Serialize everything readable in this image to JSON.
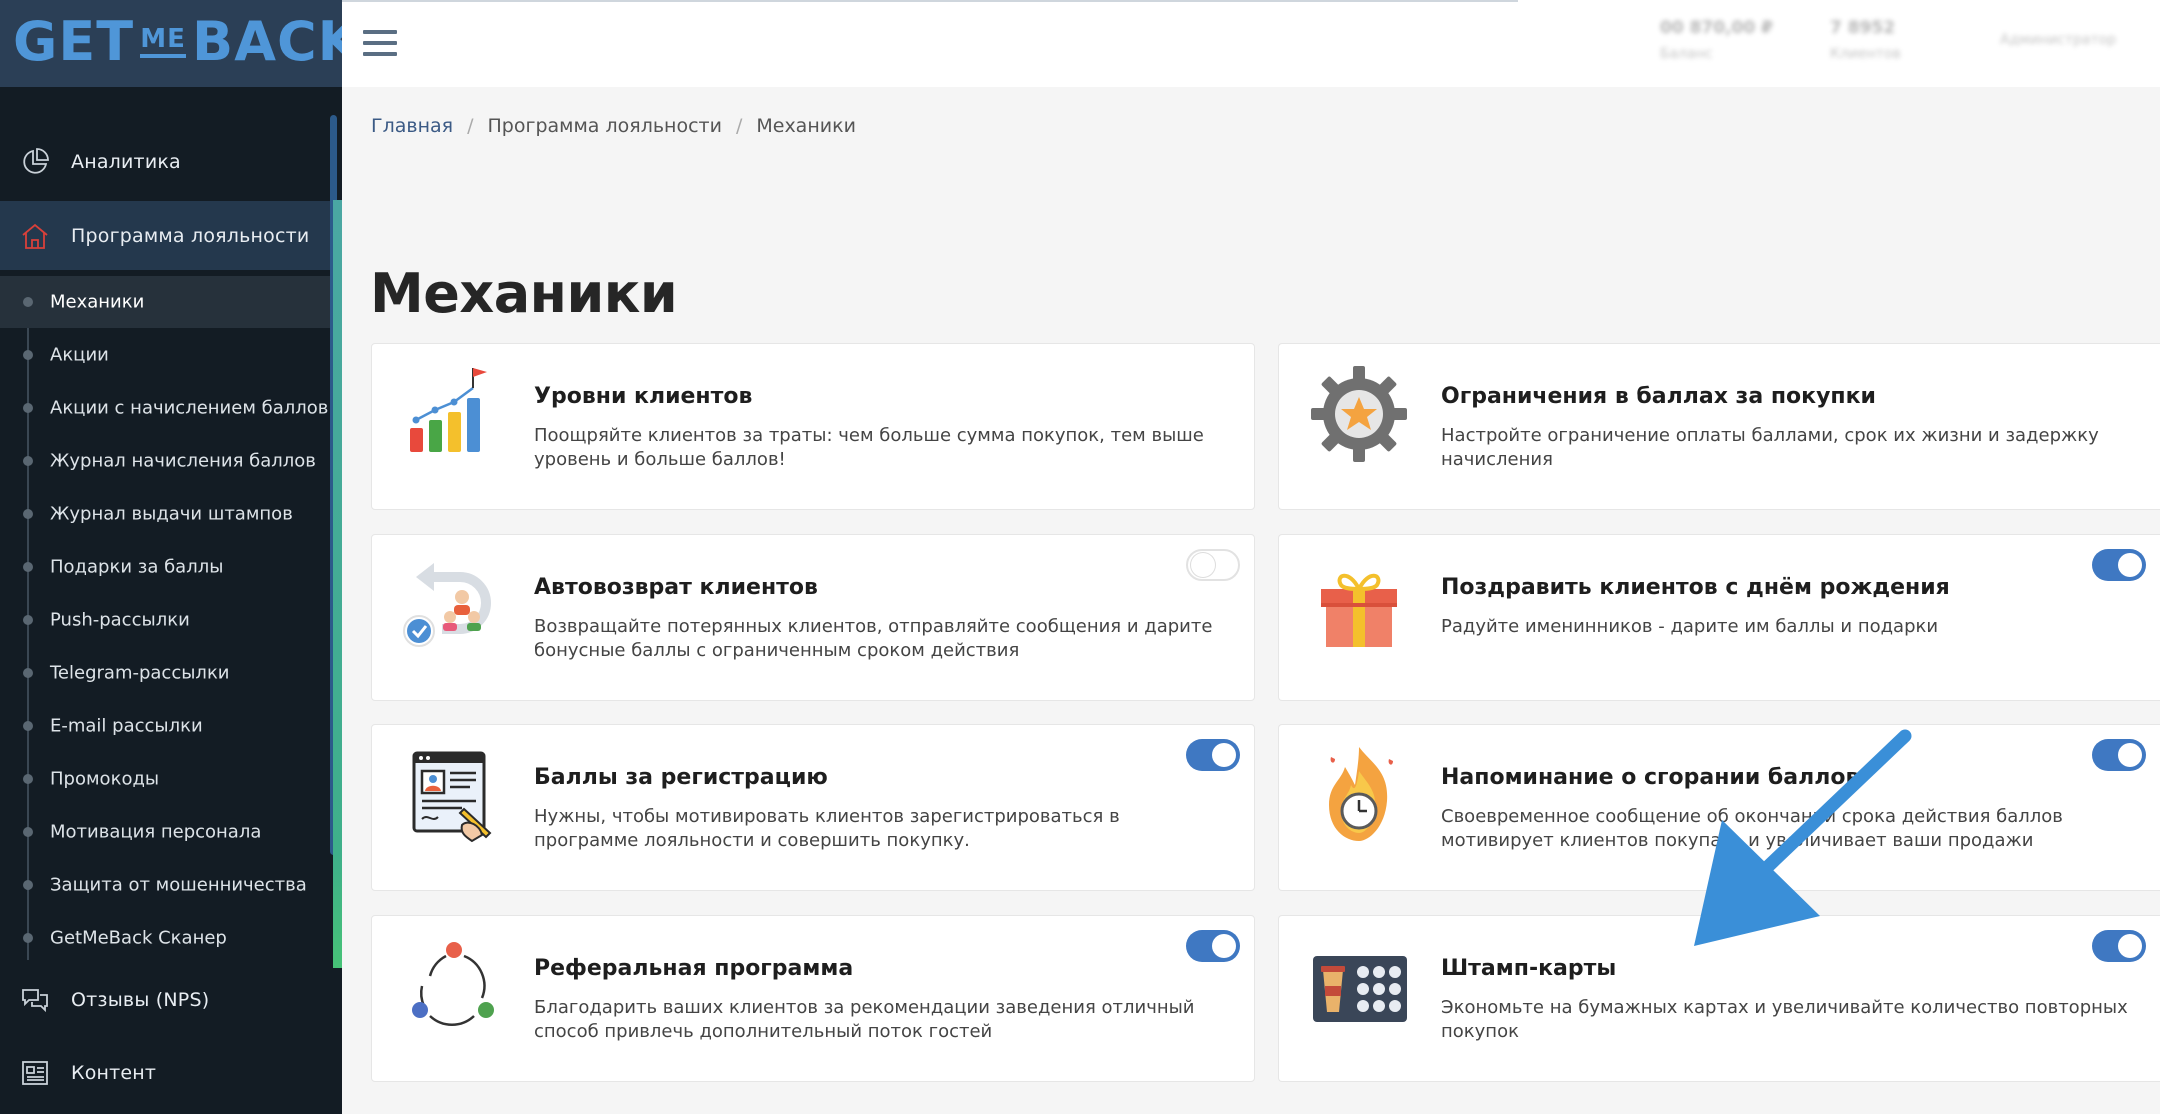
{
  "logo": {
    "left": "GET",
    "middle": "ME",
    "right": "BACK"
  },
  "sidebar": {
    "analytics": {
      "label": "Аналитика",
      "icon": "pie-chart-icon"
    },
    "loyalty": {
      "label": "Программа лояльности",
      "icon": "home-icon",
      "icon_color": "#d9403a"
    },
    "sub_items": [
      "Механики",
      "Акции",
      "Акции с начислением баллов",
      "Журнал начисления баллов",
      "Журнал выдачи штампов",
      "Подарки за баллы",
      "Push-рассылки",
      "Telegram-рассылки",
      "E-mail рассылки",
      "Промокоды",
      "Мотивация персонала",
      "Защита от мошенничества",
      "GetMeBack Сканер"
    ],
    "active_sub": "Механики",
    "nps": {
      "label": "Отзывы (NPS)",
      "icon": "chat-bubbles-icon"
    },
    "content": {
      "label": "Контент",
      "icon": "document-icon"
    }
  },
  "topbar": {
    "stats": [
      {
        "value": "00 870,00 ₽",
        "label": "Баланс"
      },
      {
        "value": "7 8952",
        "label": "Клиентов"
      },
      {
        "value": "Администратор",
        "label": ""
      }
    ]
  },
  "breadcrumb": {
    "home": "Главная",
    "section": "Программа лояльности",
    "current": "Механики"
  },
  "page": {
    "title": "Механики"
  },
  "mechanics": [
    {
      "title": "Уровни клиентов",
      "description": "Поощряйте клиентов за траты: чем больше сумма покупок, тем выше уровень и больше баллов!",
      "icon": "levels-chart-icon",
      "toggle": null
    },
    {
      "title": "Ограничения в баллах за покупки",
      "description": "Настройте ограничение оплаты баллами, срок их жизни и задержку начисления",
      "icon": "gear-star-icon",
      "toggle": null
    },
    {
      "title": "Автовозврат клиентов",
      "description": "Возвращайте потерянных клиентов, отправляйте сообщения и дарите бонусные баллы с ограниченным сроком действия",
      "icon": "return-customers-icon",
      "toggle": false
    },
    {
      "title": "Поздравить клиентов с днём рождения",
      "description": "Радуйте именинников - дарите им баллы и подарки",
      "icon": "gift-box-icon",
      "toggle": true
    },
    {
      "title": "Баллы за регистрацию",
      "description": "Нужны, чтобы мотивировать клиентов зарегистрироваться в программе лояльности и совершить покупку.",
      "icon": "registration-form-icon",
      "toggle": true
    },
    {
      "title": "Напоминание о сгорании баллов",
      "description": "Своевременное сообщение об окончании срока действия баллов мотивирует клиентов покупать и увеличивает ваши продажи",
      "icon": "burning-clock-icon",
      "toggle": true
    },
    {
      "title": "Реферальная программа",
      "description": "Благодарить ваших клиентов за рекомендации заведения отличный способ привлечь дополнительный поток гостей",
      "icon": "referral-cycle-icon",
      "toggle": true
    },
    {
      "title": "Штамп-карты",
      "description": "Экономьте на бумажных картах и увеличивайте количество повторных покупок",
      "icon": "stamp-card-icon",
      "toggle": true
    }
  ],
  "colors": {
    "sidebar_bg": "#131c24",
    "logo_bg": "#2b3f56",
    "accent_blue": "#3f78c2",
    "annotation_arrow": "#3a8fd8"
  }
}
